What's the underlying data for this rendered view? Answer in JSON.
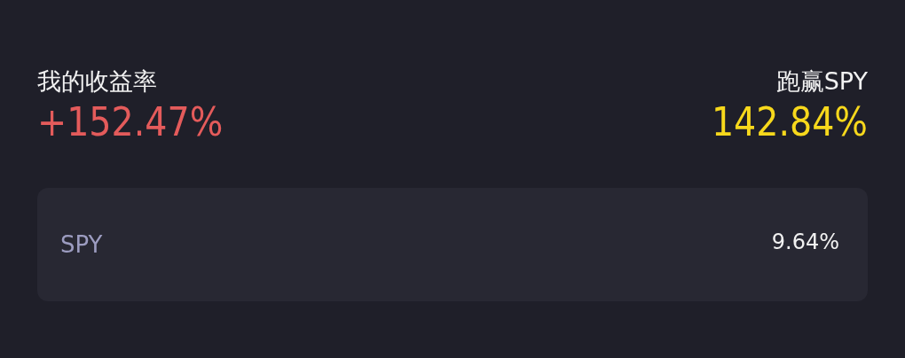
{
  "my_return": {
    "label": "我的收益率",
    "value": "+152.47%"
  },
  "beat": {
    "label": "跑赢SPY",
    "value": "142.84%"
  },
  "benchmark": {
    "name": "SPY",
    "value": "9.64%"
  }
}
